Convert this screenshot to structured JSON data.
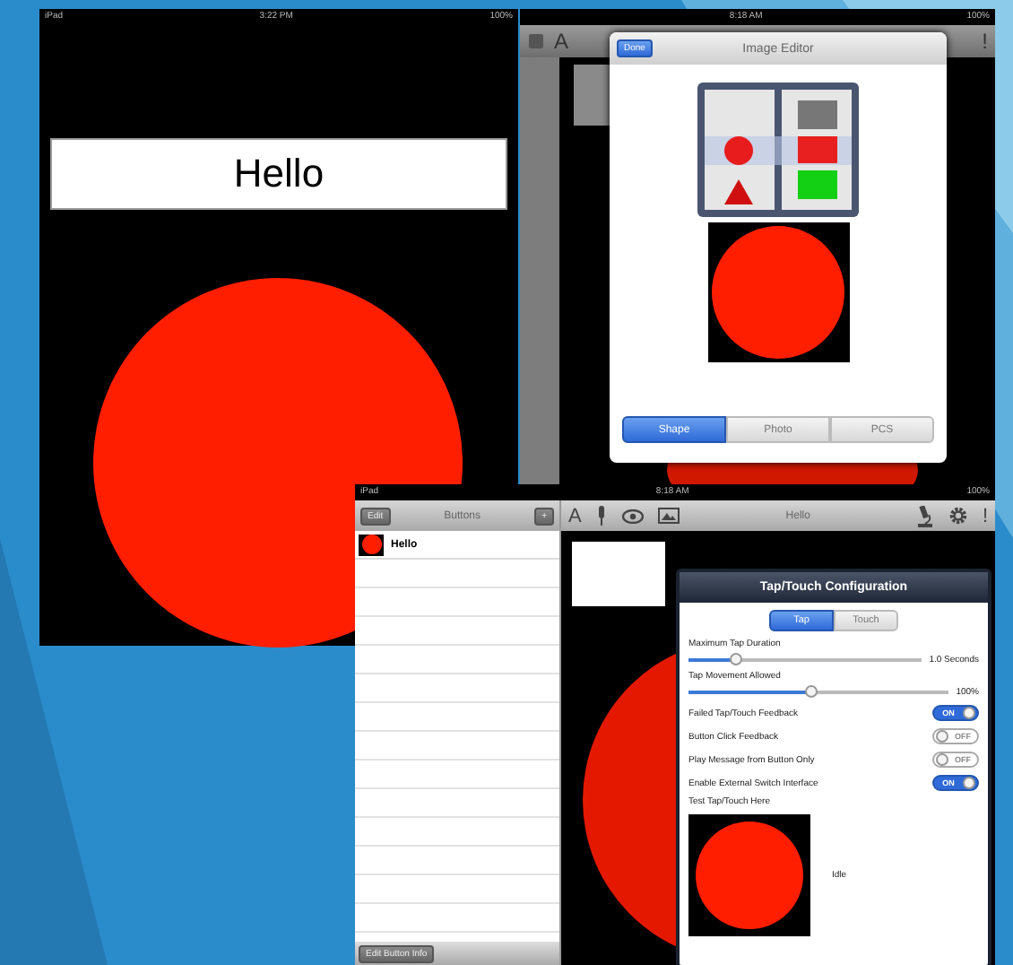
{
  "canvas_screen": {
    "status": {
      "carrier": "iPad",
      "time": "3:22 PM",
      "battery": "100%"
    },
    "label": "Hello"
  },
  "editor_screen": {
    "status": {
      "time": "8:18 AM",
      "battery": "100%"
    },
    "toolbar": {
      "font_glyph": "A",
      "alert_glyph": "!"
    },
    "popover": {
      "done_button": "Done",
      "title": "Image Editor",
      "tabs": [
        {
          "label": "Shape",
          "selected": true
        },
        {
          "label": "Photo",
          "selected": false
        },
        {
          "label": "PCS",
          "selected": false
        }
      ]
    }
  },
  "config_screen": {
    "status": {
      "carrier": "iPad",
      "time": "8:18 AM",
      "battery": "100%"
    },
    "sidebar": {
      "edit_button": "Edit",
      "title": "Buttons",
      "add_button": "+",
      "items": [
        {
          "label": "Hello"
        }
      ],
      "footer_button": "Edit Button Info"
    },
    "toolbar": {
      "font_glyph": "A",
      "title": "Hello",
      "alert_glyph": "!"
    },
    "popover": {
      "title": "Tap/Touch Configuration",
      "tabs": [
        {
          "label": "Tap",
          "selected": true
        },
        {
          "label": "Touch",
          "selected": false
        }
      ],
      "sliders": [
        {
          "label": "Maximum Tap Duration",
          "level": 0.2,
          "reading": "1.0 Seconds"
        },
        {
          "label": "Tap Movement Allowed",
          "level": 0.47,
          "reading": "100%"
        }
      ],
      "switches": [
        {
          "label": "Failed Tap/Touch Feedback",
          "on": true,
          "switch_label": "ON"
        },
        {
          "label": "Button Click Feedback",
          "on": false,
          "switch_label": "OFF"
        },
        {
          "label": "Play Message from Button Only",
          "on": false,
          "switch_label": "OFF"
        },
        {
          "label": "Enable External Switch Interface",
          "on": true,
          "switch_label": "ON"
        }
      ],
      "test_label": "Test Tap/Touch Here",
      "test_state": "Idle"
    }
  }
}
